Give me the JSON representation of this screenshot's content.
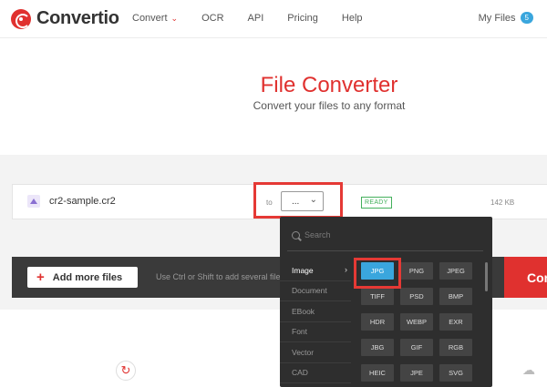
{
  "header": {
    "logo": "Convertio",
    "nav": [
      {
        "label": "Convert",
        "has_dropdown": true
      },
      {
        "label": "OCR"
      },
      {
        "label": "API"
      },
      {
        "label": "Pricing"
      },
      {
        "label": "Help"
      }
    ],
    "my_files_label": "My Files",
    "my_files_count": "5"
  },
  "hero": {
    "title": "File Converter",
    "subtitle": "Convert your files to any format"
  },
  "file": {
    "name": "cr2-sample.cr2",
    "to_label": "to",
    "selected_format": "...",
    "status": "READY",
    "size": "142 KB"
  },
  "actions": {
    "add_more": "Add more files",
    "hint": "Use Ctrl or Shift to add several files a",
    "convert": "Convert"
  },
  "dropdown": {
    "search_placeholder": "Search",
    "categories": [
      "Image",
      "Document",
      "EBook",
      "Font",
      "Vector",
      "CAD"
    ],
    "active_category": "Image",
    "formats": [
      "JPG",
      "PNG",
      "JPEG",
      "TIFF",
      "PSD",
      "BMP",
      "HDR",
      "WEBP",
      "EXR",
      "JBG",
      "GIF",
      "RGB",
      "HEIC",
      "JPE",
      "SVG"
    ],
    "selected_format": "JPG"
  },
  "colors": {
    "brand": "#e0312f",
    "accent": "#3aa6dd",
    "ready": "#44b05c",
    "dropdown_bg": "#2e2e2e",
    "highlight": "#e53935"
  },
  "icons": {
    "logo": "convertio-logo-icon",
    "convert_chevron": "chevron-down-icon",
    "file": "image-file-icon",
    "select_chevron": "chevron-down-icon",
    "search": "search-icon",
    "category_arrow": "chevron-right-icon",
    "add": "plus-icon",
    "bottom_left": "sync-icon",
    "bottom_right": "cloud-upload-icon"
  }
}
